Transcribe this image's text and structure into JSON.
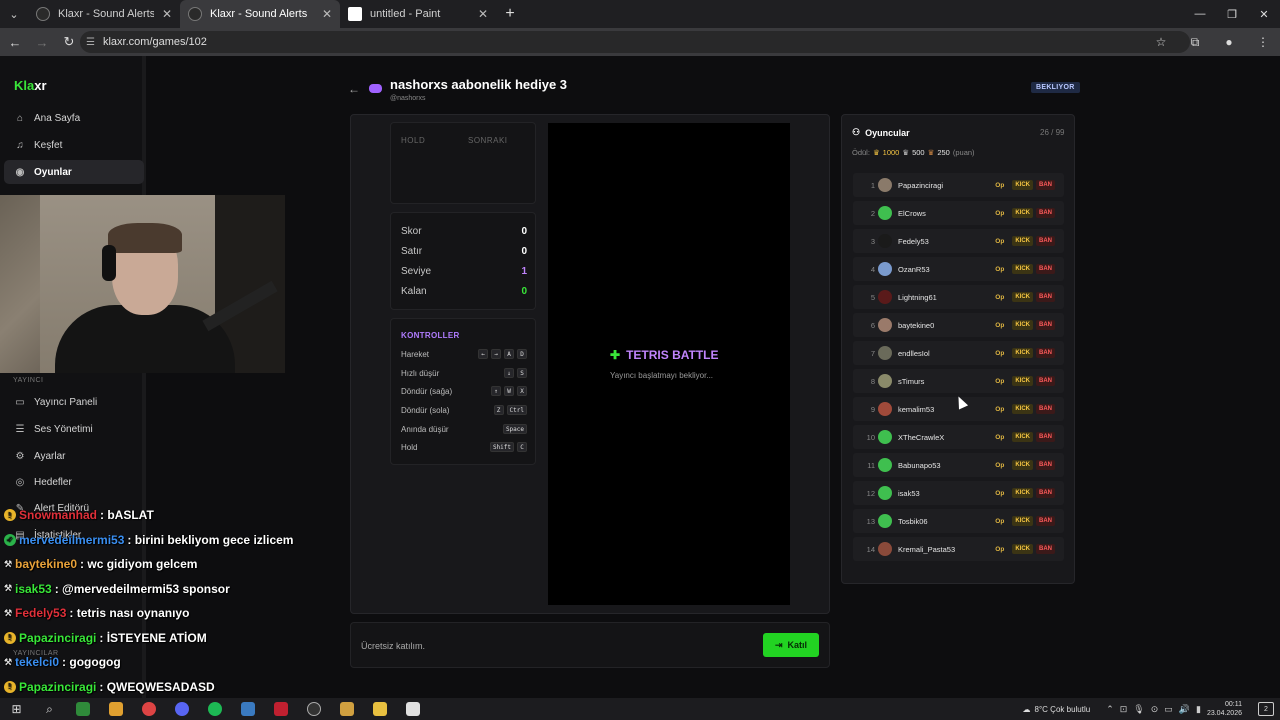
{
  "browser": {
    "tabs": [
      {
        "title": "Klaxr - Sound Alerts",
        "active": false
      },
      {
        "title": "Klaxr - Sound Alerts",
        "active": true
      },
      {
        "title": "untitled - Paint",
        "active": false
      }
    ],
    "url": "klaxr.com/games/102"
  },
  "sidebar": {
    "logo_a": "Kla",
    "logo_b": "xr",
    "items": [
      {
        "label": "Ana Sayfa",
        "icon": "home-icon"
      },
      {
        "label": "Keşfet",
        "icon": "music-icon"
      },
      {
        "label": "Oyunlar",
        "icon": "gamepad-icon"
      }
    ],
    "section_label": "YAYINCI",
    "streamer_items": [
      {
        "label": "Yayıncı Paneli",
        "icon": "monitor-icon"
      },
      {
        "label": "Ses Yönetimi",
        "icon": "list-icon"
      },
      {
        "label": "Ayarlar",
        "icon": "gear-icon"
      },
      {
        "label": "Hedefler",
        "icon": "target-icon"
      },
      {
        "label": "Alert Editörü",
        "icon": "edit-icon"
      },
      {
        "label": "İstatistikler",
        "icon": "chart-icon"
      }
    ],
    "section_label_2": "YAYINCILAR"
  },
  "game": {
    "title": "nashorxs aabonelik hediye 3",
    "subtitle": "@nashorxs",
    "status": "BEKLIYOR",
    "hold_label": "HOLD",
    "next_label": "SONRAKI",
    "stats": [
      {
        "label": "Skor",
        "value": "0"
      },
      {
        "label": "Satır",
        "value": "0"
      },
      {
        "label": "Seviye",
        "value": "1"
      },
      {
        "label": "Kalan",
        "value": "0"
      }
    ],
    "controls_title": "KONTROLLER",
    "controls": [
      {
        "label": "Hareket",
        "keys": [
          "←",
          "→",
          "A",
          "D"
        ]
      },
      {
        "label": "Hızlı düşür",
        "keys": [
          "↓",
          "S"
        ]
      },
      {
        "label": "Döndür (sağa)",
        "keys": [
          "↑",
          "W",
          "X"
        ]
      },
      {
        "label": "Döndür (sola)",
        "keys": [
          "Z",
          "Ctrl"
        ]
      },
      {
        "label": "Anında düşür",
        "keys": [
          "Space"
        ]
      },
      {
        "label": "Hold",
        "keys": [
          "Shift",
          "C"
        ]
      }
    ],
    "board_title": "TETRIS BATTLE",
    "board_subtitle": "Yayıncı başlatmayı bekliyor...",
    "join_text": "Ücretsiz katılım.",
    "join_button": "Katıl"
  },
  "players": {
    "title": "Oyuncular",
    "count": "26 / 99",
    "prize_label": "Ödül:",
    "prize_1": "1000",
    "prize_2": "500",
    "prize_3": "250",
    "prize_unit": "(puan)",
    "op_label": "Op",
    "kick_label": "KICK",
    "ban_label": "BAN",
    "list": [
      {
        "rank": "1",
        "name": "Papazinciragi",
        "color": "#8a7a6a"
      },
      {
        "rank": "2",
        "name": "ElCrows",
        "color": "#3fbf4f"
      },
      {
        "rank": "3",
        "name": "Fedely53",
        "color": "#1a1a1a"
      },
      {
        "rank": "4",
        "name": "OzanR53",
        "color": "#7a9acd"
      },
      {
        "rank": "5",
        "name": "Lightning61",
        "color": "#5a1a1a"
      },
      {
        "rank": "6",
        "name": "baytekine0",
        "color": "#9a7a6a"
      },
      {
        "rank": "7",
        "name": "endllesIol",
        "color": "#6a6a5a"
      },
      {
        "rank": "8",
        "name": "sTimurs",
        "color": "#8a8a6a"
      },
      {
        "rank": "9",
        "name": "kemalim53",
        "color": "#a04a3a"
      },
      {
        "rank": "10",
        "name": "XTheCrawleX",
        "color": "#3fbf4f"
      },
      {
        "rank": "11",
        "name": "Babunapo53",
        "color": "#3fbf4f"
      },
      {
        "rank": "12",
        "name": "isak53",
        "color": "#3fbf4f"
      },
      {
        "rank": "13",
        "name": "Tosbik06",
        "color": "#3fbf4f"
      },
      {
        "rank": "14",
        "name": "Kremali_Pasta53",
        "color": "#8a4a3a"
      }
    ]
  },
  "chat": [
    {
      "user": "Snowmanhad",
      "color": "#e0303a",
      "msg": " : bASLAT",
      "badge": "gold"
    },
    {
      "user": "mervedeilmermi53",
      "color": "#3a8ef0",
      "msg": " : birini bekliyom gece izlicem",
      "badge": "green"
    },
    {
      "user": "baytekine0",
      "color": "#e8a23a",
      "msg": " : wc gidiyom gelcem",
      "badge": "tool"
    },
    {
      "user": "isak53",
      "color": "#39e639",
      "msg": " : @mervedeilmermi53 sponsor",
      "badge": "tool"
    },
    {
      "user": "Fedely53",
      "color": "#e0303a",
      "msg": " : tetris nası oynanıyo",
      "badge": "tool"
    },
    {
      "user": "Papazinciragi",
      "color": "#39e639",
      "msg": " : İSTEYENE ATİOM",
      "badge": "gold"
    },
    {
      "user": "tekelci0",
      "color": "#3a8ef0",
      "msg": " : gogogog",
      "badge": "tool"
    },
    {
      "user": "Papazinciragi",
      "color": "#39e639",
      "msg": " : QWEQWESADASD",
      "badge": "gold"
    }
  ],
  "taskbar": {
    "weather": "8°C  Çok bulutlu",
    "time": "00:11",
    "date": "23.04.2026",
    "notif_count": "2"
  }
}
